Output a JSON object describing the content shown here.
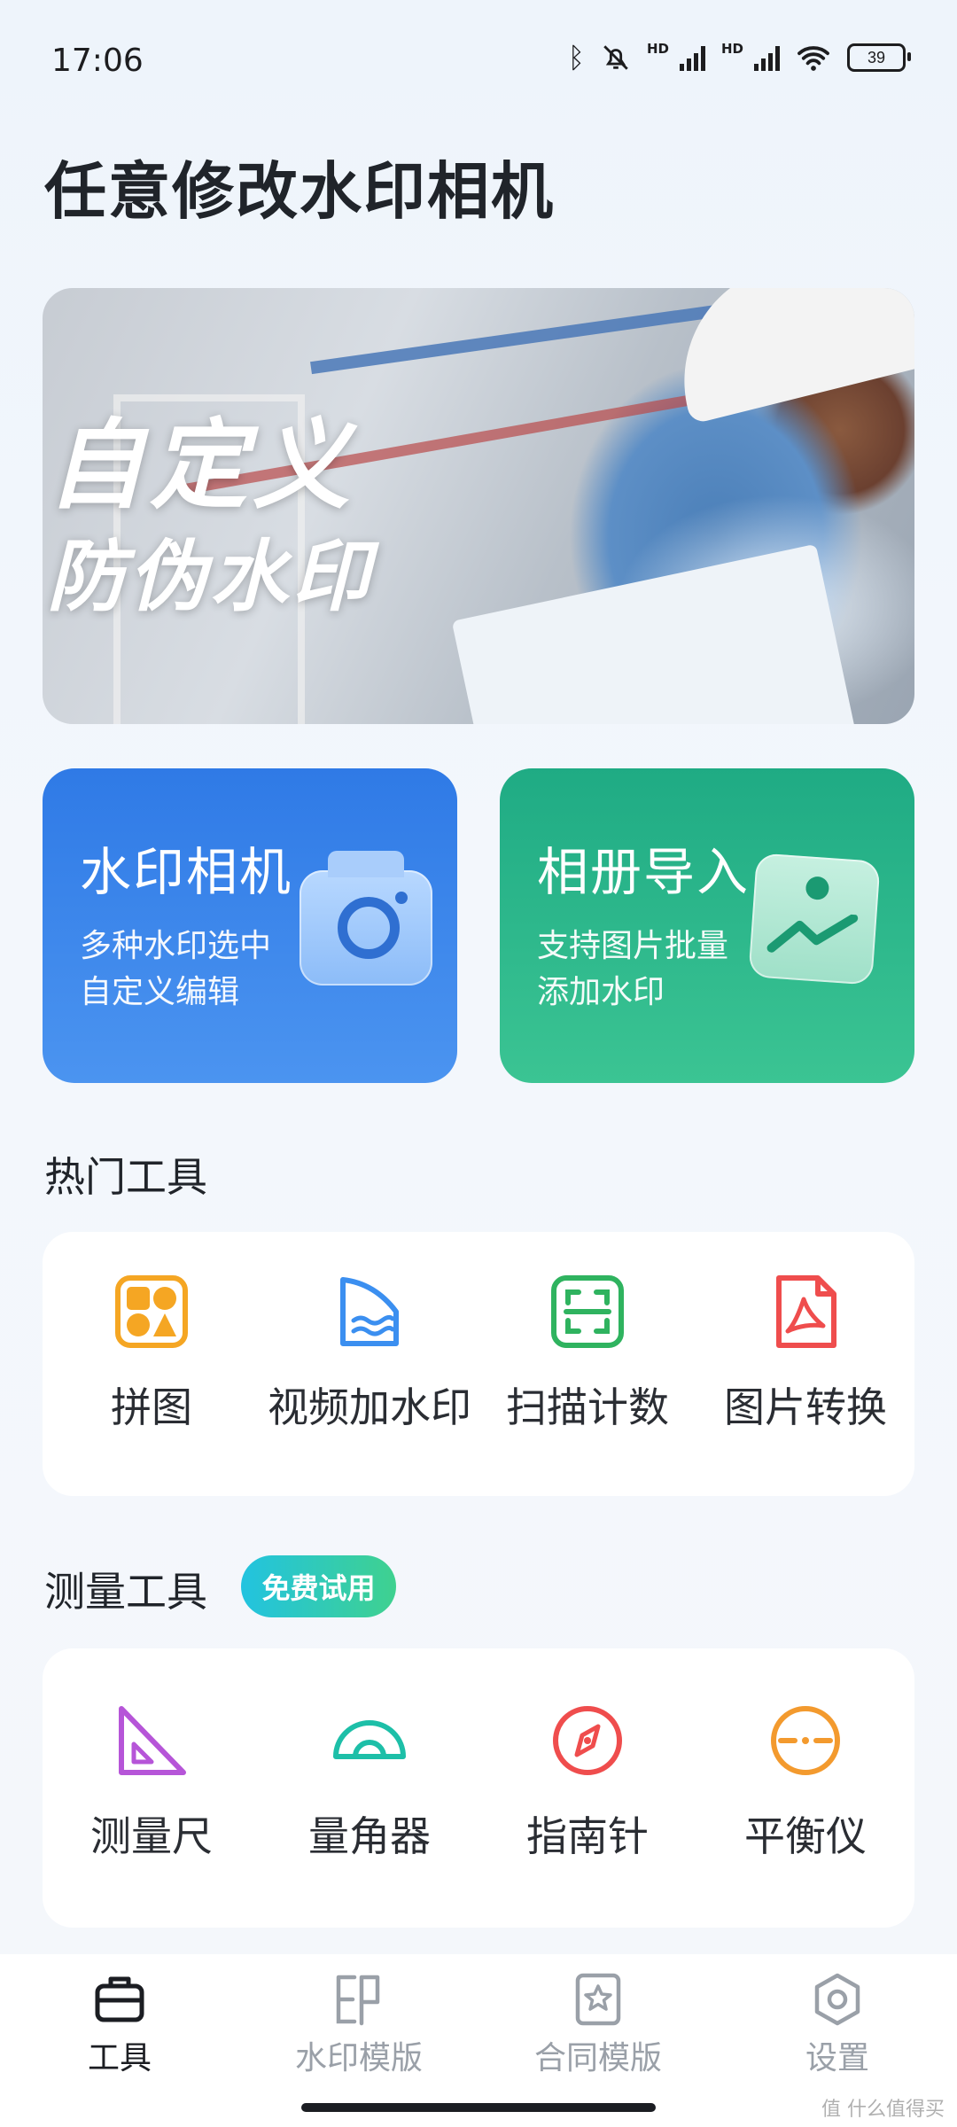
{
  "status_bar": {
    "time": "17:06",
    "battery": "39",
    "hd1": "HD",
    "hd2": "HD"
  },
  "app_title": "任意修改水印相机",
  "banner": {
    "line1": "自定义",
    "line2": "防伪水印"
  },
  "feature_cards": [
    {
      "title": "水印相机",
      "sub1": "多种水印选中",
      "sub2": "自定义编辑"
    },
    {
      "title": "相册导入",
      "sub1": "支持图片批量",
      "sub2": "添加水印"
    }
  ],
  "hot_tools": {
    "title": "热门工具",
    "items": [
      {
        "label": "拼图",
        "icon": "puzzle-icon",
        "color": "#f5a623"
      },
      {
        "label": "视频加水印",
        "icon": "video-watermark-icon",
        "color": "#3b8ff0"
      },
      {
        "label": "扫描计数",
        "icon": "scan-icon",
        "color": "#2fb35f"
      },
      {
        "label": "图片转换",
        "icon": "pdf-icon",
        "color": "#ef4d4d"
      }
    ]
  },
  "measure_tools": {
    "title": "测量工具",
    "badge": "免费试用",
    "items": [
      {
        "label": "测量尺",
        "icon": "ruler-triangle-icon",
        "color": "#b655d8"
      },
      {
        "label": "量角器",
        "icon": "protractor-icon",
        "color": "#1dbfa8"
      },
      {
        "label": "指南针",
        "icon": "compass-icon",
        "color": "#ef4d4d"
      },
      {
        "label": "平衡仪",
        "icon": "level-icon",
        "color": "#f39a2e"
      }
    ]
  },
  "tab_bar": {
    "tabs": [
      {
        "label": "工具",
        "icon": "toolbox-icon",
        "active": true
      },
      {
        "label": "水印模版",
        "icon": "watermark-template-icon",
        "active": false
      },
      {
        "label": "合同模版",
        "icon": "contract-template-icon",
        "active": false
      },
      {
        "label": "设置",
        "icon": "settings-icon",
        "active": false
      }
    ]
  },
  "watermark_text": "值 什么值得买"
}
